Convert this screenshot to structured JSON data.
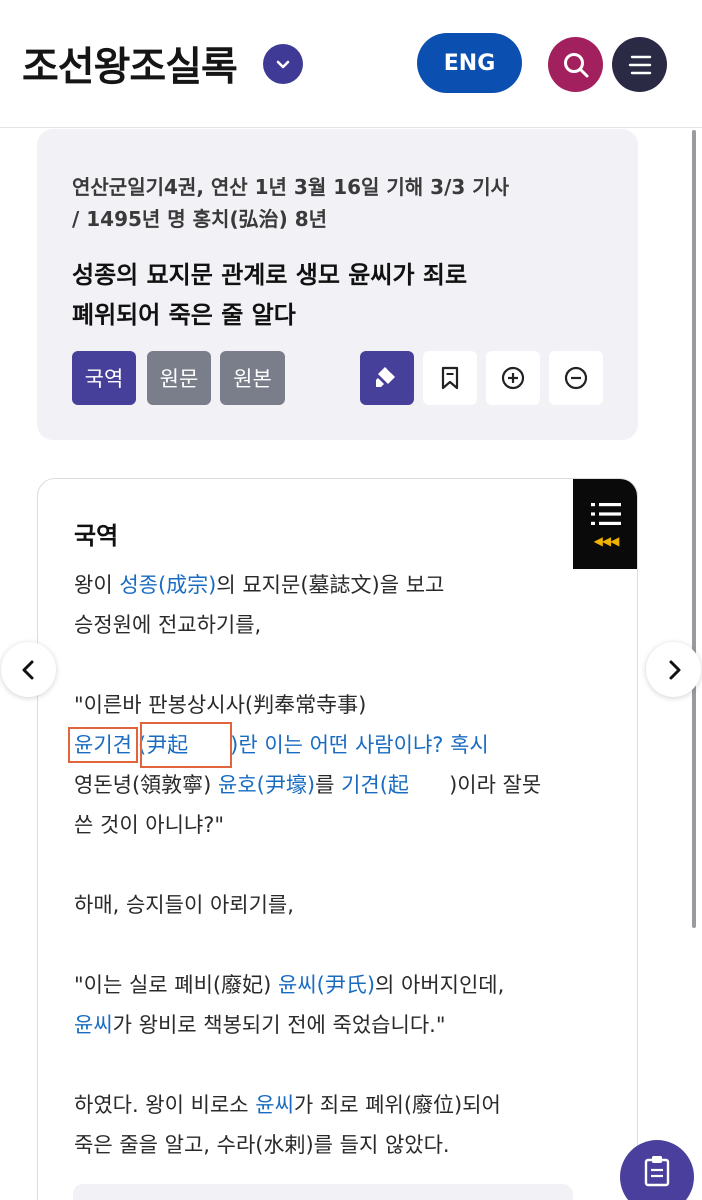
{
  "header": {
    "title": "조선왕조실록",
    "lang_button": "ENG",
    "icons": {
      "dropdown": "chevron-down-icon",
      "search": "search-icon",
      "menu": "menu-icon"
    },
    "colors": {
      "dropdown": "#3f3a96",
      "eng": "#0b4fb0",
      "search": "#a3205e",
      "menu": "#2a2a44"
    }
  },
  "info": {
    "meta_line1": "연산군일기4권, 연산 1년 3월 16일 기해 3/3 기사",
    "meta_line2": "/ 1495년 명 홍치(弘治) 8년",
    "title_line1": "성종의 묘지문 관계로 생모 윤씨가 죄로",
    "title_line2": "폐위되어 죽은 줄 알다",
    "tabs": [
      {
        "label": "국역",
        "active": true
      },
      {
        "label": "원문",
        "active": false
      },
      {
        "label": "원본",
        "active": false
      }
    ],
    "tools": [
      "highlighter-icon",
      "bookmark-icon",
      "zoom-in-icon",
      "zoom-out-icon"
    ]
  },
  "content": {
    "heading": "국역",
    "p1_a": "왕이 ",
    "p1_link": "성종(成宗)",
    "p1_b": "의 묘지문(墓誌文)을 보고",
    "p1_line2": "승정원에 전교하기를,",
    "p2_line1": "\"이른바 판봉상시사(判奉常寺事)",
    "p2_name": "윤기견",
    "p2_paren_open": "(",
    "p2_hanja": "尹起",
    "p2_rest": ")란 이는 어떤 사람이냐? 혹시",
    "p2_l3_a": "영돈녕(領敦寧) ",
    "p2_l3_link1": "윤호(尹壕)",
    "p2_l3_b": "를 ",
    "p2_l3_link2": "기견(起",
    "p2_l3_c": ")이라 잘못",
    "p2_line4": "쓴 것이 아니냐?\"",
    "p3": "하매, 승지들이 아뢰기를,",
    "p4_a": "\"이는 실로 폐비(廢妃) ",
    "p4_link1": "윤씨(尹氏)",
    "p4_b": "의 아버지인데,",
    "p4_link2": "윤씨",
    "p4_c": "가 왕비로 책봉되기 전에 죽었습니다.\"",
    "p5_a": "하였다. 왕이 비로소 ",
    "p5_link": "윤씨",
    "p5_b": "가 죄로 폐위(廢位)되어",
    "p5_line2": "죽은 줄을 알고, 수라(水剌)를 들지 않았다."
  },
  "toc": {
    "icon": "list-icon",
    "arrows": "◀◀◀"
  },
  "nav": {
    "prev_icon": "chevron-left-icon",
    "next_icon": "chevron-right-icon"
  },
  "fab": {
    "icon": "clipboard-icon"
  },
  "colors": {
    "link": "#1a6cc2",
    "highlight_box": "#e0643c",
    "accent": "#46409a"
  }
}
